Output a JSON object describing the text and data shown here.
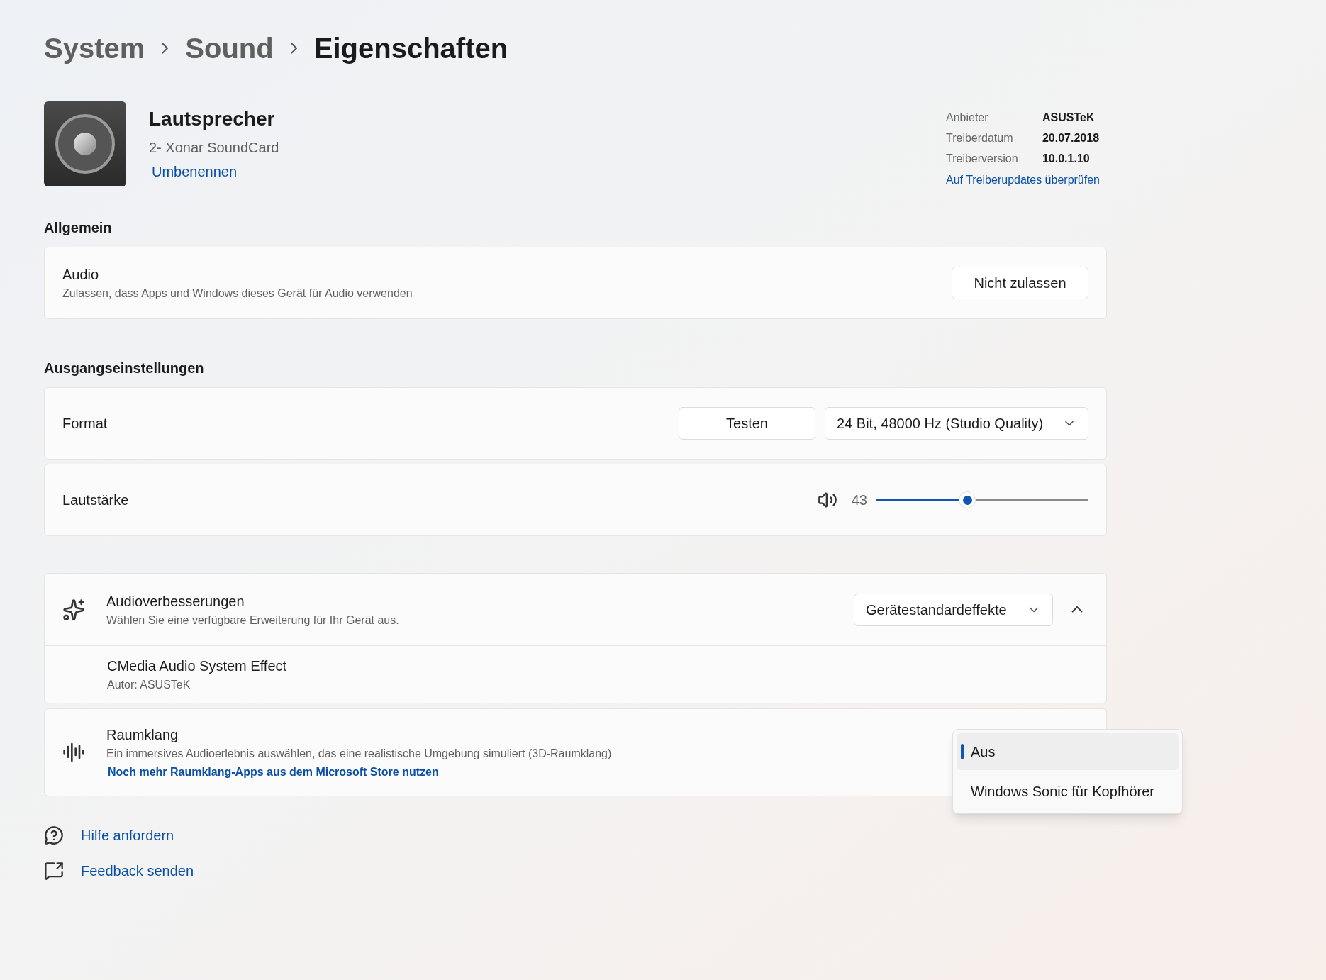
{
  "breadcrumb": [
    {
      "label": "System",
      "current": false
    },
    {
      "label": "Sound",
      "current": false
    },
    {
      "label": "Eigenschaften",
      "current": true
    }
  ],
  "device": {
    "name": "Lautsprecher",
    "description": "2- Xonar SoundCard",
    "rename_link": "Umbenennen"
  },
  "driver_info": [
    {
      "label": "Anbieter",
      "value": "ASUSTeK"
    },
    {
      "label": "Treiberdatum",
      "value": "20.07.2018"
    },
    {
      "label": "Treiberversion",
      "value": "10.0.1.10"
    }
  ],
  "driver_link": "Auf Treiberupdates überprüfen",
  "general": {
    "heading": "Allgemein",
    "title": "Audio",
    "subtitle": "Zulassen, dass Apps und Windows dieses Gerät für Audio verwenden",
    "button": "Nicht zulassen"
  },
  "output": {
    "heading": "Ausgangseinstellungen",
    "format_label": "Format",
    "test_button": "Testen",
    "format_value": "24 Bit, 48000 Hz (Studio Quality)",
    "volume_label": "Lautstärke",
    "volume": {
      "reading": "43",
      "level": 0.43
    }
  },
  "enhancements": {
    "title": "Audioverbesserungen",
    "subtitle": "Wählen Sie eine verfügbare Erweiterung für Ihr Gerät aus.",
    "value": "Gerätestandardeffekte",
    "expanded": true,
    "effect_title": "CMedia Audio System Effect",
    "effect_author": "Autor: ASUSTeK"
  },
  "spatial": {
    "title": "Raumklang",
    "subtitle": "Ein immersives Audioerlebnis auswählen, das eine realistische Umgebung simuliert (3D-Raumklang)",
    "link": "Noch mehr Raumklang-Apps aus dem Microsoft Store nutzen"
  },
  "spatial_menu": [
    {
      "label": "Aus",
      "selected": true
    },
    {
      "label": "Windows Sonic für Kopfhörer",
      "selected": false
    }
  ],
  "footer_links": [
    {
      "kind": "help",
      "label": "Hilfe anfordern"
    },
    {
      "kind": "feedback",
      "label": "Feedback senden"
    }
  ]
}
